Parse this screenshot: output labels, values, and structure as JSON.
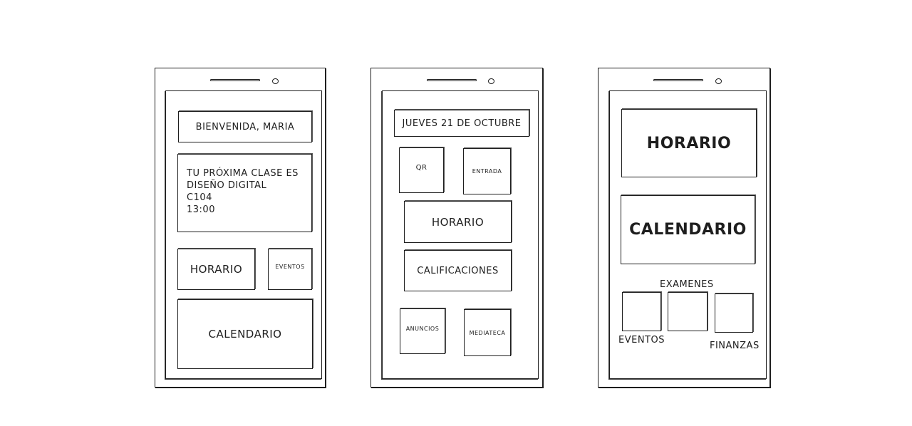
{
  "phone1": {
    "welcome": "Bienvenida, Maria",
    "next_class_line1": "Tu próxima clase es",
    "next_class_line2": "diseño digital",
    "room": "C104",
    "time": "13:00",
    "horario": "Horario",
    "eventos": "Eventos",
    "calendario": "Calendario"
  },
  "phone2": {
    "date": "Jueves 21 de octubre",
    "qr": "QR",
    "entrada": "Entrada",
    "horario": "Horario",
    "calificaciones": "Calificaciones",
    "anuncios": "Anuncios",
    "mediateca": "Mediateca"
  },
  "phone3": {
    "horario": "Horario",
    "calendario": "Calendario",
    "examenes": "Examenes",
    "eventos": "Eventos",
    "finanzas": "Finanzas"
  }
}
